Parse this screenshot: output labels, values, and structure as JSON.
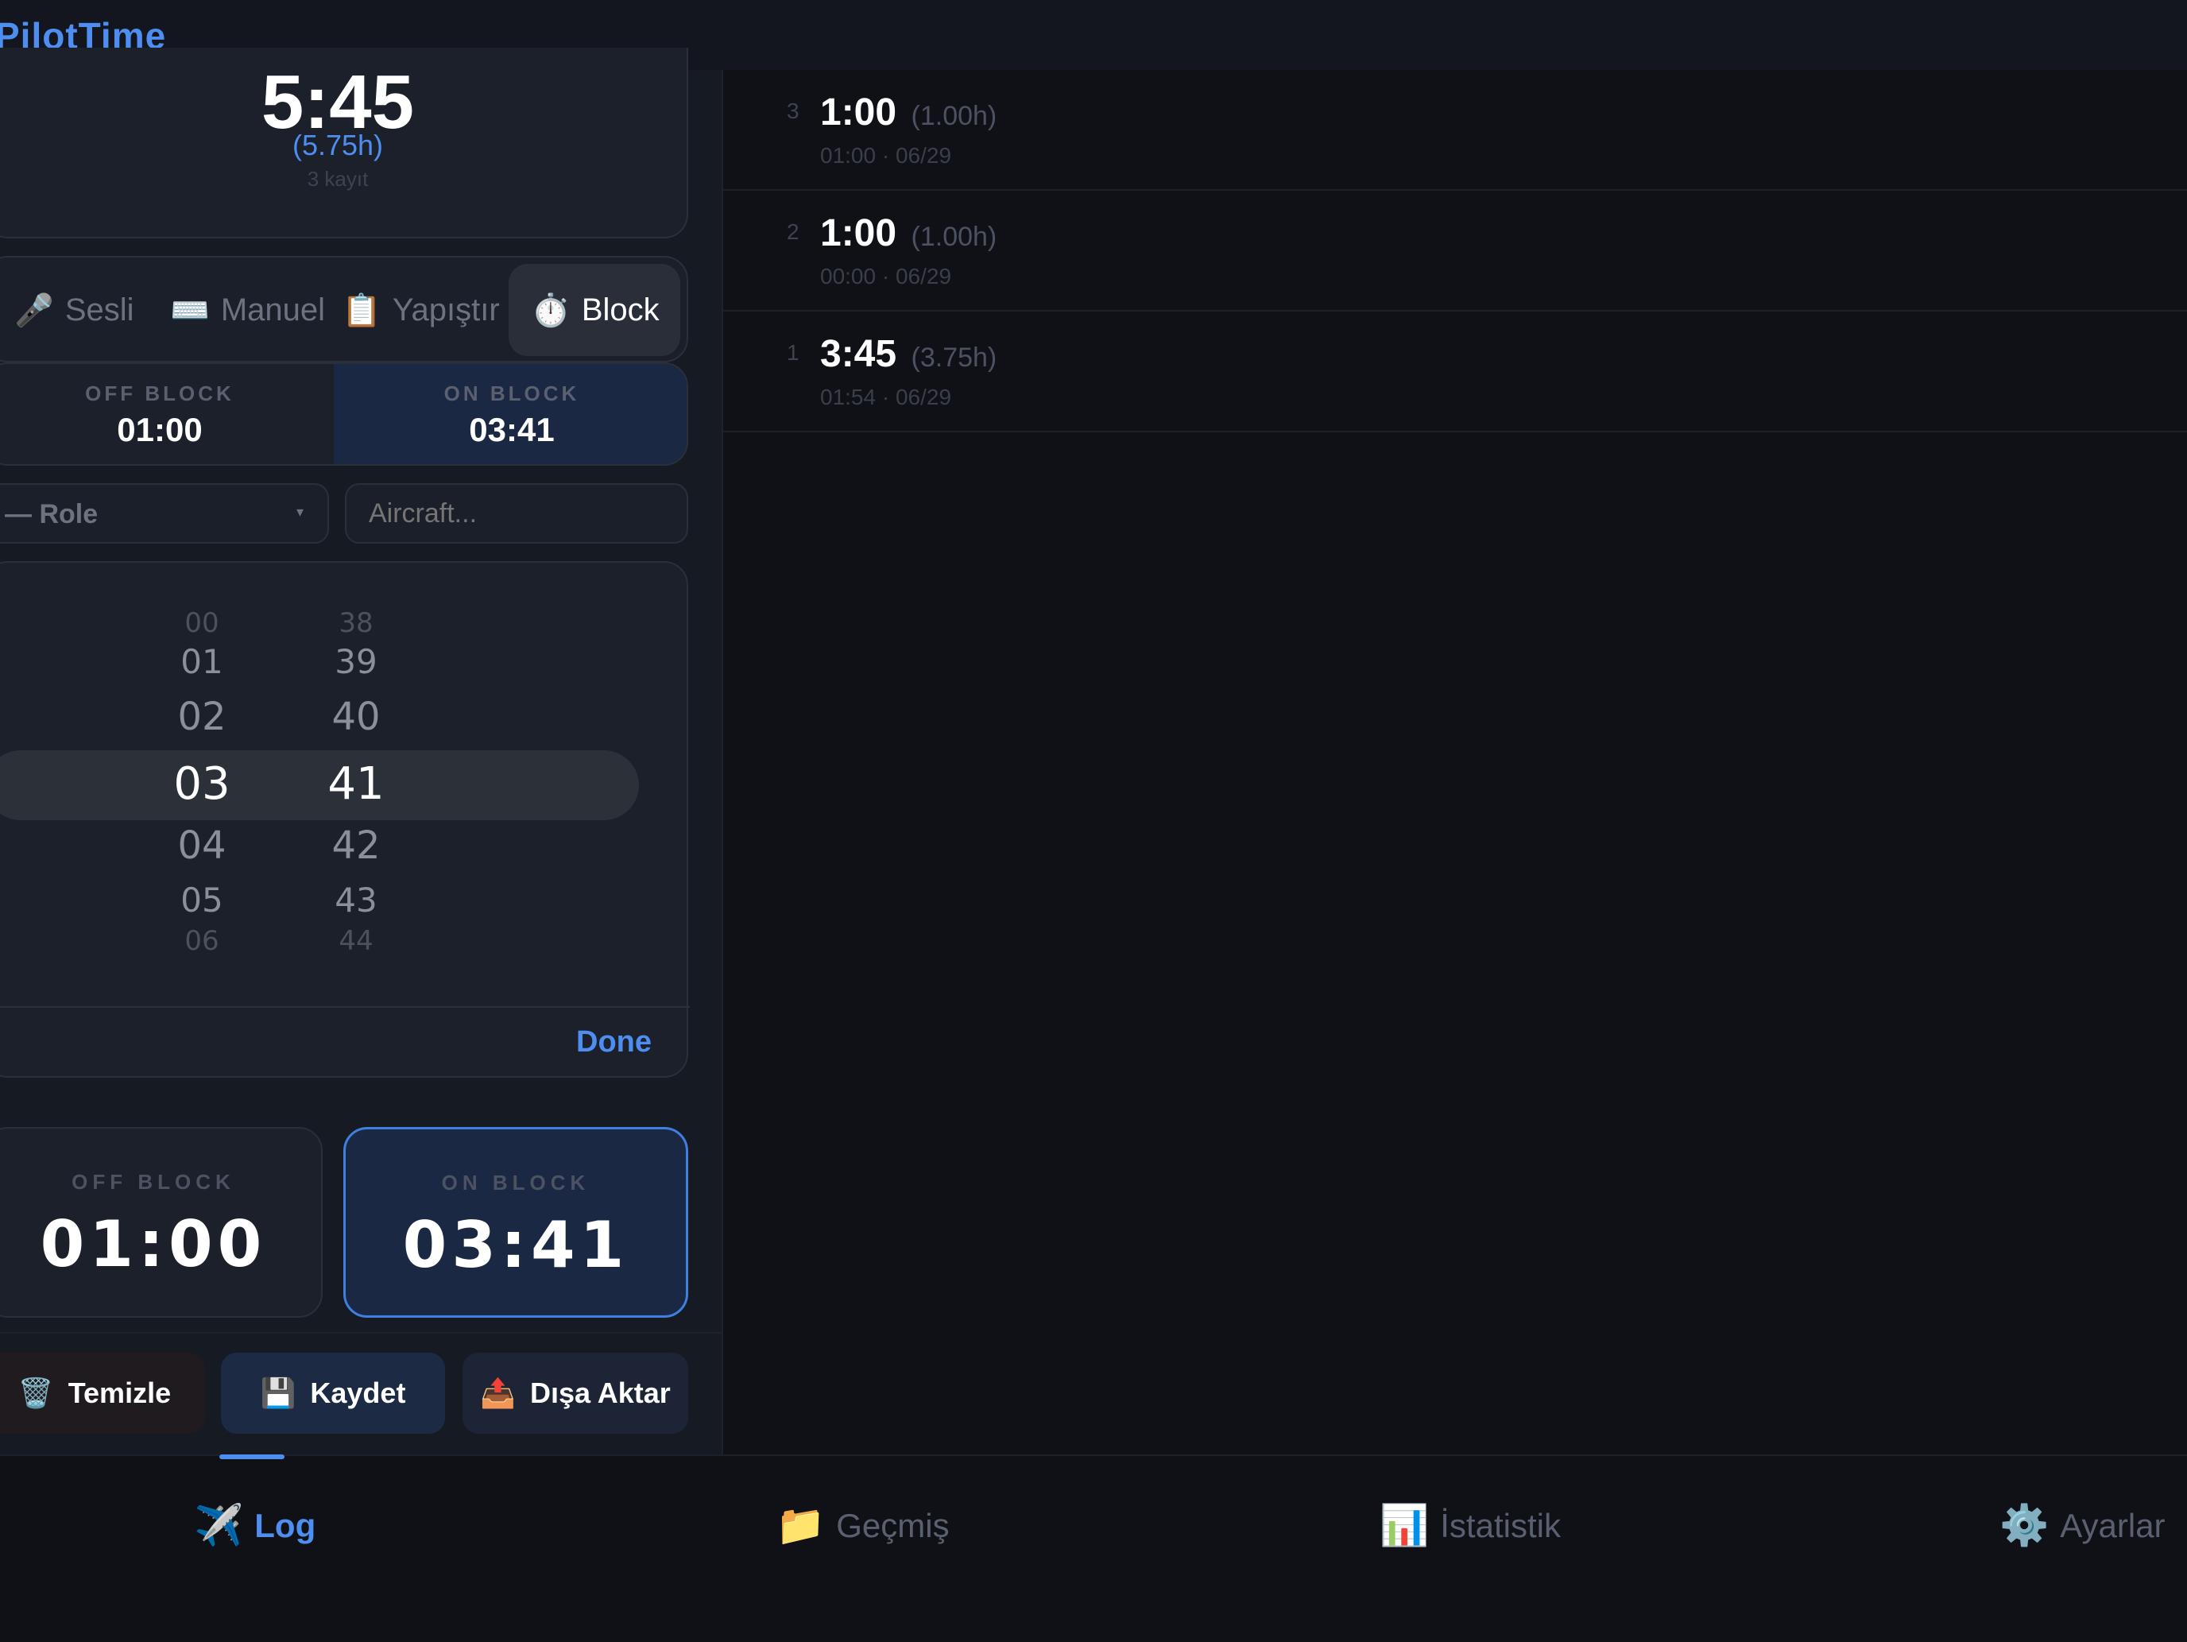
{
  "app": {
    "title": "PilotTime"
  },
  "summary": {
    "total": "5:45",
    "hours": "(5.75h)",
    "count": "3 kayıt"
  },
  "modes": [
    {
      "icon": "🎤",
      "label": "Sesli"
    },
    {
      "icon": "⌨️",
      "label": "Manuel"
    },
    {
      "icon": "📋",
      "label": "Yapıştır"
    },
    {
      "icon": "⏱️",
      "label": "Block"
    }
  ],
  "blocks": {
    "off_label": "OFF BLOCK",
    "off_value": "01:00",
    "on_label": "ON BLOCK",
    "on_value": "03:41"
  },
  "role": {
    "label": "— Role",
    "caret": "▾"
  },
  "aircraft": {
    "placeholder": "Aircraft..."
  },
  "picker": {
    "hours": [
      "00",
      "01",
      "02",
      "03",
      "04",
      "05",
      "06"
    ],
    "minutes": [
      "38",
      "39",
      "40",
      "41",
      "42",
      "43",
      "44"
    ],
    "selected_hour": "03",
    "selected_minute": "41",
    "done_label": "Done"
  },
  "big_blocks": {
    "off_label": "OFF BLOCK",
    "off_value": "01:00",
    "on_label": "ON BLOCK",
    "on_value": "03:41"
  },
  "actions": {
    "clear": {
      "icon": "🗑️",
      "label": "Temizle"
    },
    "save": {
      "icon": "💾",
      "label": "Kaydet"
    },
    "export": {
      "icon": "📤",
      "label": "Dışa Aktar"
    }
  },
  "entries": [
    {
      "index": "3",
      "time": "1:00",
      "hours": "(1.00h)",
      "sub": "01:00 · 06/29"
    },
    {
      "index": "2",
      "time": "1:00",
      "hours": "(1.00h)",
      "sub": "00:00 · 06/29"
    },
    {
      "index": "1",
      "time": "3:45",
      "hours": "(3.75h)",
      "sub": "01:54 · 06/29"
    }
  ],
  "tabs": [
    {
      "icon": "✈️",
      "label": "Log"
    },
    {
      "icon": "📁",
      "label": "Geçmiş"
    },
    {
      "icon": "📊",
      "label": "İstatistik"
    },
    {
      "icon": "⚙️",
      "label": "Ayarlar"
    }
  ],
  "colors": {
    "accent": "#4d8ef0",
    "background": "#0f1117",
    "panel": "#161a23"
  }
}
